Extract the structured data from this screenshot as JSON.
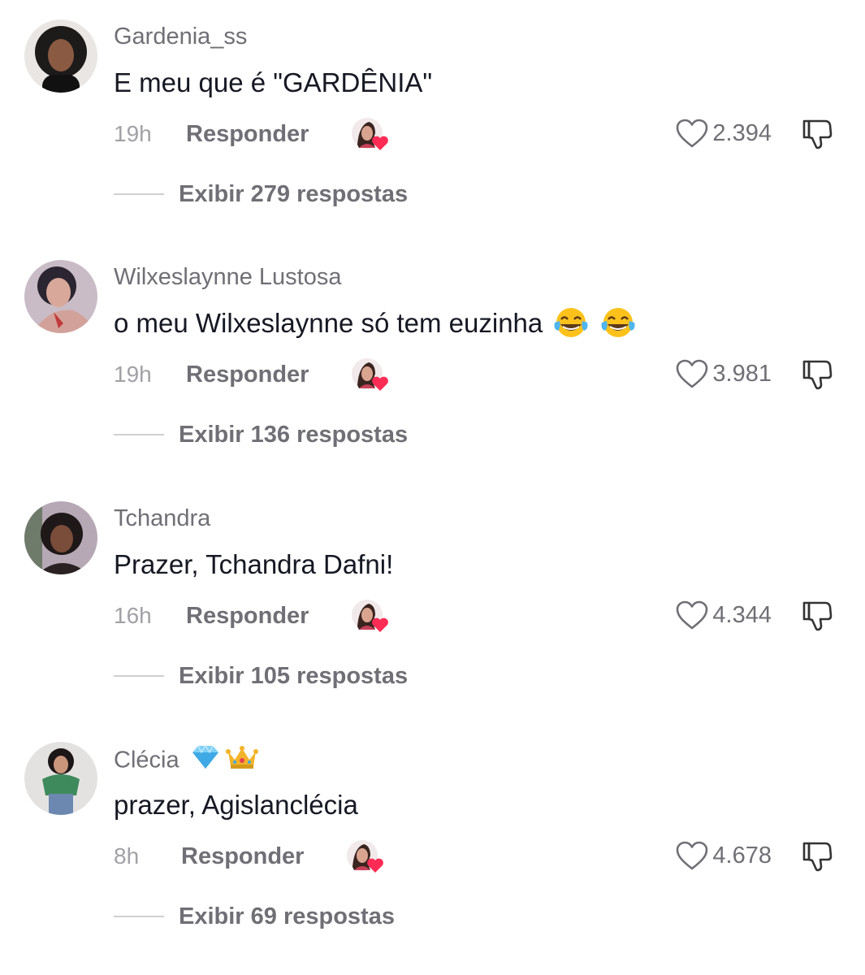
{
  "comments": [
    {
      "username": "Gardenia_ss",
      "text": "E meu que é \"GARDÊNIA\"",
      "time": "19h",
      "reply_label": "Responder",
      "likes": "2.394",
      "view_replies": "Exibir 279 respostas",
      "avatar_color": "#1d1a1a"
    },
    {
      "username": "Wilxeslaynne Lustosa",
      "text": "o meu Wilxeslaynne só tem euzinha",
      "text_emojis": [
        "face-with-tears-of-joy",
        "face-with-tears-of-joy"
      ],
      "time": "19h",
      "reply_label": "Responder",
      "likes": "3.981",
      "view_replies": "Exibir 136 respostas",
      "avatar_color": "#5a4a6e"
    },
    {
      "username": "Tchandra",
      "text": "Prazer, Tchandra Dafni!",
      "time": "16h",
      "reply_label": "Responder",
      "likes": "4.344",
      "view_replies": "Exibir 105 respostas",
      "avatar_color": "#7a6a7a"
    },
    {
      "username": "Clécia",
      "username_badges": [
        "gem-stone",
        "crown"
      ],
      "text": "prazer, Agislanclécia",
      "time": "8h",
      "reply_label": "Responder",
      "likes": "4.678",
      "view_replies": "Exibir 69 respostas",
      "avatar_color": "#3f8a5c"
    }
  ],
  "colors": {
    "primary_text": "#161823",
    "secondary_text": "#6f6f75",
    "muted_text": "#a1a1a6",
    "creator_heart": "#fe2c55"
  },
  "icons": {
    "like": "heart-outline-icon",
    "dislike": "thumbs-down-icon",
    "creator_like": "creator-liked-avatar-icon"
  }
}
